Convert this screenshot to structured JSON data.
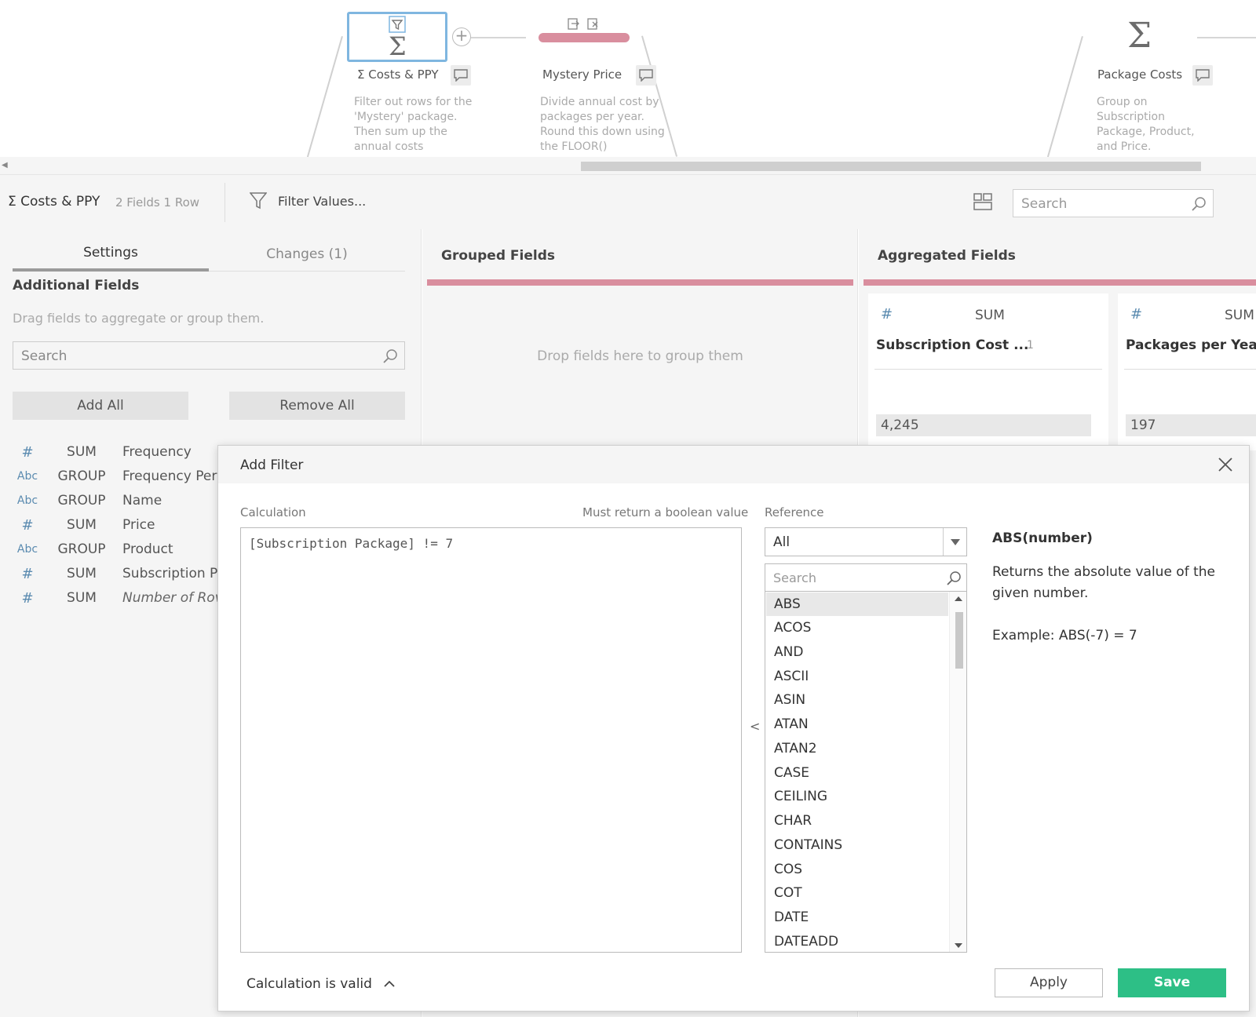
{
  "flow": {
    "steps": [
      {
        "title": "Σ Costs & PPY",
        "description": "Filter out rows for the 'Mystery' package. Then sum up the annual costs"
      },
      {
        "title": "Mystery Price",
        "description": "Divide annual cost by packages per year. Round this down using the FLOOR()"
      },
      {
        "title": "Package Costs",
        "description": "Group on Subscription Package, Product, and Price."
      }
    ],
    "icons": {
      "filter": "filter-icon",
      "sigma": "sigma-icon",
      "comment": "comment-icon",
      "add": "plus-icon"
    }
  },
  "toolbar": {
    "step_name": "Σ Costs & PPY",
    "meta": "2 Fields  1 Row",
    "filter_label": "Filter Values...",
    "search_placeholder": "Search"
  },
  "left_panel": {
    "tabs": [
      {
        "label": "Settings",
        "active": true
      },
      {
        "label": "Changes (1)",
        "active": false
      }
    ],
    "heading": "Additional Fields",
    "hint": "Drag fields to aggregate or group them.",
    "search_placeholder": "Search",
    "add_all": "Add All",
    "remove_all": "Remove All",
    "fields": [
      {
        "type": "#",
        "agg": "SUM",
        "name": "Frequency"
      },
      {
        "type": "Abc",
        "agg": "GROUP",
        "name": "Frequency Per"
      },
      {
        "type": "Abc",
        "agg": "GROUP",
        "name": "Name"
      },
      {
        "type": "#",
        "agg": "SUM",
        "name": "Price"
      },
      {
        "type": "Abc",
        "agg": "GROUP",
        "name": "Product"
      },
      {
        "type": "#",
        "agg": "SUM",
        "name": "Subscription P"
      },
      {
        "type": "#",
        "agg": "SUM",
        "name": "Number of Rov",
        "italic": true
      }
    ]
  },
  "grouped": {
    "title": "Grouped Fields",
    "drop_hint": "Drop fields here to group them"
  },
  "aggregated": {
    "title": "Aggregated Fields",
    "cards": [
      {
        "type": "#",
        "agg": "SUM",
        "name": "Subscription Cost ...",
        "count": "1",
        "value": "4,245"
      },
      {
        "type": "#",
        "agg": "SUM",
        "name": "Packages per Year",
        "count": "",
        "value": "197"
      }
    ]
  },
  "dialog": {
    "title": "Add Filter",
    "calc_label": "Calculation",
    "calc_hint": "Must return a boolean value",
    "calculation": "[Subscription Package] != 7",
    "reference_label": "Reference",
    "reference_value": "All",
    "search_placeholder": "Search",
    "functions": [
      "ABS",
      "ACOS",
      "AND",
      "ASCII",
      "ASIN",
      "ATAN",
      "ATAN2",
      "CASE",
      "CEILING",
      "CHAR",
      "CONTAINS",
      "COS",
      "COT",
      "DATE",
      "DATEADD"
    ],
    "selected_function": "ABS",
    "fn_signature": "ABS(number)",
    "fn_description": "Returns the absolute value of the given number.",
    "fn_example": "Example: ABS(-7) = 7",
    "status": "Calculation is valid",
    "apply_label": "Apply",
    "save_label": "Save",
    "colors": {
      "save": "#2dbf86",
      "accent_bar": "#d98e9e",
      "selected_step_border": "#7fb6e0"
    }
  }
}
